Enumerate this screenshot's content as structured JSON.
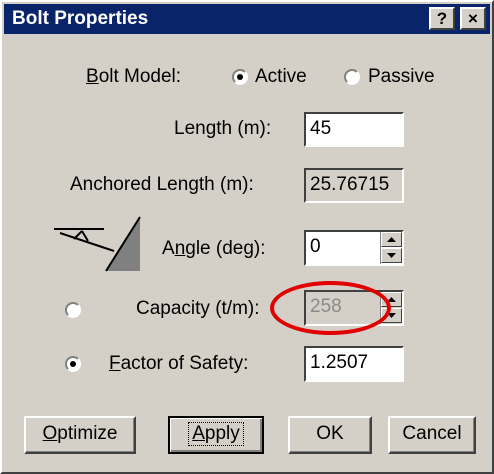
{
  "window": {
    "title": "Bolt Properties",
    "help_button": "?",
    "close_button": "×"
  },
  "bolt_model": {
    "label": "Bolt Model:",
    "label_access_key": "B",
    "label_rest": "olt Model:",
    "options": [
      {
        "label": "Active",
        "selected": true
      },
      {
        "label": "Passive",
        "selected": false
      }
    ]
  },
  "length": {
    "label": "Length (m):",
    "value": "45"
  },
  "anchored_length": {
    "label": "Anchored Length (m):",
    "value": "25.76715"
  },
  "angle": {
    "label": "Angle (deg):",
    "label_pre": "A",
    "label_access_key": "n",
    "label_rest": "gle (deg):",
    "value": "0"
  },
  "capacity": {
    "label": "Capacity (t/m):",
    "value": "258",
    "selected": false,
    "disabled": true
  },
  "factor_of_safety": {
    "label": "Factor of Safety:",
    "label_access_key": "F",
    "label_rest": "actor of Safety:",
    "value": "1.2507",
    "selected": true
  },
  "buttons": {
    "optimize": {
      "label": "Optimize",
      "access_key": "O",
      "rest": "ptimize"
    },
    "apply": {
      "label": "Apply",
      "access_key": "A",
      "rest": "pply"
    },
    "ok": {
      "label": "OK"
    },
    "cancel": {
      "label": "Cancel"
    }
  },
  "annotation": {
    "color": "#e00000",
    "shape": "ellipse around capacity field"
  }
}
